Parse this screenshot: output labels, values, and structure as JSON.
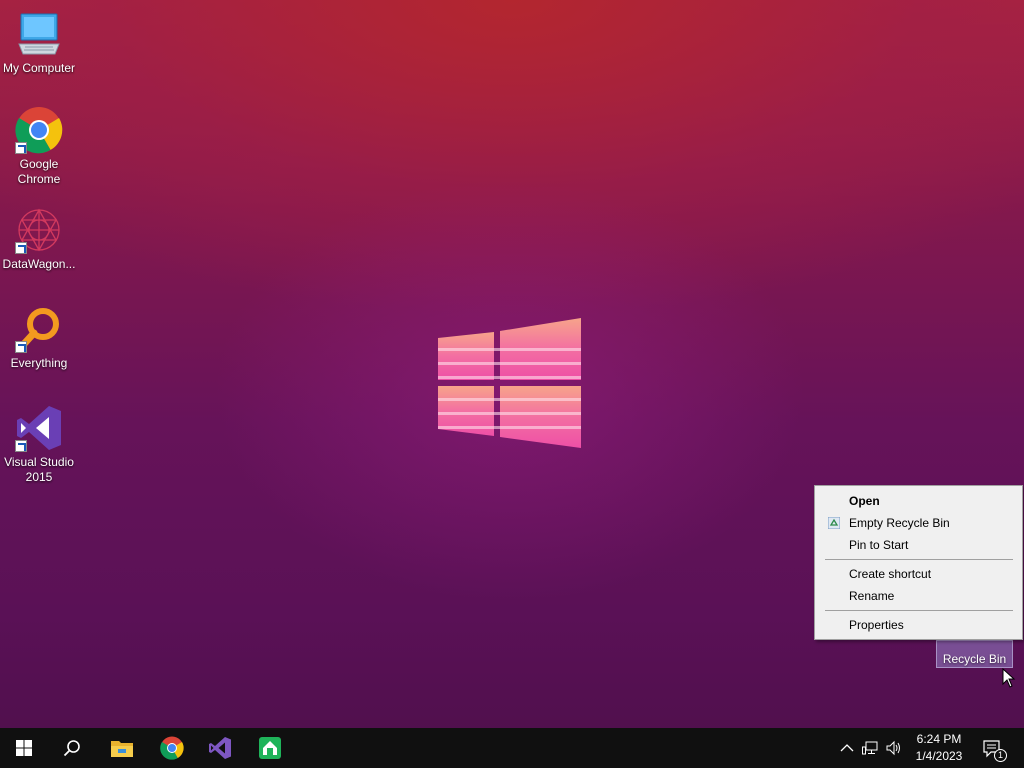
{
  "desktop": {
    "icons": [
      {
        "label": "My Computer",
        "icon": "my-computer-icon"
      },
      {
        "label_line1": "Google",
        "label_line2": "Chrome",
        "icon": "chrome-icon"
      },
      {
        "label": "DataWagon...",
        "icon": "datawagon-icon"
      },
      {
        "label": "Everything",
        "icon": "everything-search-icon"
      },
      {
        "label_line1": "Visual Studio",
        "label_line2": "2015",
        "icon": "visual-studio-icon"
      }
    ],
    "recycle_bin": {
      "label": "Recycle Bin",
      "icon": "recycle-bin-icon"
    }
  },
  "context_menu": {
    "items": [
      {
        "label": "Open",
        "bold": true
      },
      {
        "label": "Empty Recycle Bin",
        "icon": "recycle-small-icon"
      },
      {
        "label": "Pin to Start"
      },
      {
        "label": "Create shortcut"
      },
      {
        "label": "Rename"
      },
      {
        "label": "Properties"
      }
    ]
  },
  "taskbar": {
    "buttons": [
      "start-icon",
      "search-icon",
      "file-explorer-icon",
      "chrome-icon",
      "visual-studio-icon",
      "green-app-icon"
    ],
    "tray": [
      "chevron-up-icon",
      "network-icon",
      "volume-icon"
    ],
    "clock": {
      "time": "6:24 PM",
      "date": "1/4/2023"
    },
    "notifications": {
      "count": "1"
    }
  },
  "colors": {
    "accent_pink": "#f05aa0",
    "menu_bg": "#f0f0f0",
    "taskbar_bg": "#101010"
  }
}
